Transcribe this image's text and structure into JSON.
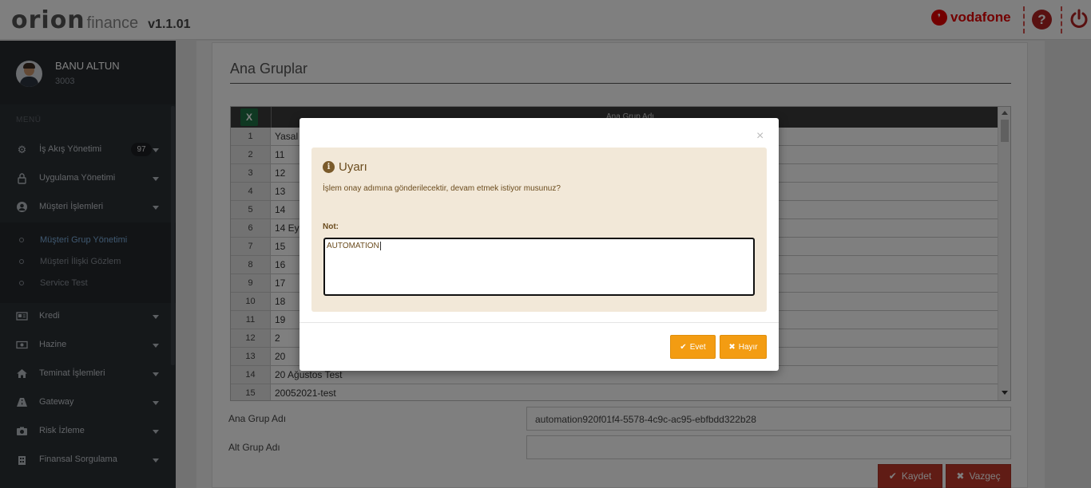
{
  "header": {
    "logo_main": "orion",
    "logo_sub": "finance",
    "version": "v1.1.01",
    "brand": "vodafone",
    "help_glyph": "?",
    "icons": [
      "help-icon",
      "power-icon"
    ],
    "accent_color": "#e60000"
  },
  "sidebar": {
    "user_name": "BANU ALTUN",
    "user_id": "3003",
    "menu_label": "MENÜ",
    "items": [
      {
        "label": "İş Akış Yönetimi",
        "icon": "gears-icon",
        "badge": "97"
      },
      {
        "label": "Uygulama Yönetimi",
        "icon": "lock-icon"
      },
      {
        "label": "Müşteri İşlemleri",
        "icon": "user-circle-icon"
      },
      {
        "label": "Kredi",
        "icon": "id-card-icon"
      },
      {
        "label": "Hazine",
        "icon": "money-icon"
      },
      {
        "label": "Teminat İşlemleri",
        "icon": "home-icon"
      },
      {
        "label": "Gateway",
        "icon": "road-icon"
      },
      {
        "label": "Risk İzleme",
        "icon": "camera-icon"
      },
      {
        "label": "Finansal Sorgulama",
        "icon": "building-icon"
      }
    ],
    "subitems": [
      {
        "label": "Müşteri Grup Yönetimi",
        "active": true
      },
      {
        "label": "Müşteri İlişki Gözlem",
        "active": false
      },
      {
        "label": "Service Test",
        "active": false
      }
    ]
  },
  "main": {
    "title": "Ana Gruplar",
    "grid": {
      "column_header": "Ana Grup Adı",
      "export_icon": "excel-icon",
      "rows": [
        {
          "n": "1",
          "v": "Yasal"
        },
        {
          "n": "2",
          "v": "11"
        },
        {
          "n": "3",
          "v": "12"
        },
        {
          "n": "4",
          "v": "13"
        },
        {
          "n": "5",
          "v": "14"
        },
        {
          "n": "6",
          "v": "14 Ey"
        },
        {
          "n": "7",
          "v": "15"
        },
        {
          "n": "8",
          "v": "16"
        },
        {
          "n": "9",
          "v": "17"
        },
        {
          "n": "10",
          "v": "18"
        },
        {
          "n": "11",
          "v": "19"
        },
        {
          "n": "12",
          "v": "2"
        },
        {
          "n": "13",
          "v": "20"
        },
        {
          "n": "14",
          "v": "20 Ağustos Test"
        },
        {
          "n": "15",
          "v": "20052021-test"
        }
      ]
    },
    "form": {
      "ana_grup_label": "Ana Grup Adı",
      "ana_grup_value": "automation920f01f4-5578-4c9c-ac95-ebfbdd322b28",
      "alt_grup_label": "Alt Grup Adı",
      "alt_grup_value": "",
      "save_label": "Kaydet",
      "cancel_label": "Vazgeç"
    }
  },
  "modal": {
    "close_glyph": "×",
    "title": "Uyarı",
    "message": "İşlem onay adımına gönderilecektir, devam etmek istiyor musunuz?",
    "note_label": "Not:",
    "note_value": "AUTOMATION",
    "yes_label": "Evet",
    "no_label": "Hayır"
  }
}
